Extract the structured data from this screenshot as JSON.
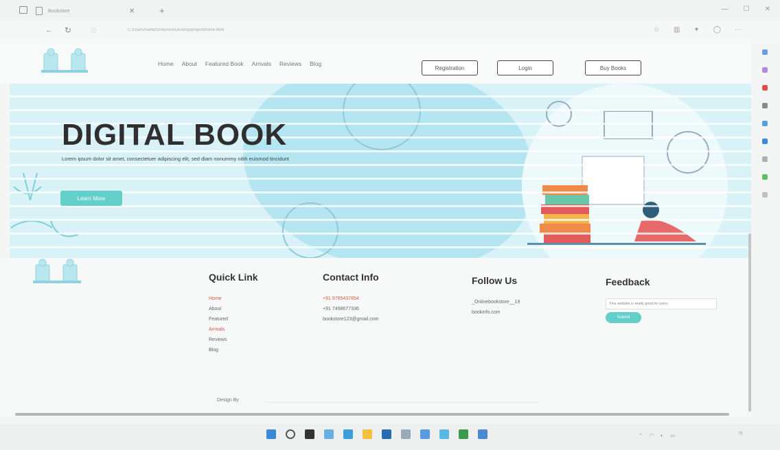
{
  "browser": {
    "tab_title": "Bookstore",
    "url": "C:/Users/name/OneDrive/Desktop/project/home.html"
  },
  "nav": {
    "links": [
      "Home",
      "About",
      "Featured Book",
      "Arrivals",
      "Reviews",
      "Blog"
    ],
    "register_label": "Registration",
    "login_label": "Login",
    "buy_label": "Buy Books"
  },
  "hero": {
    "title": "DIGITAL BOOK",
    "description": "Lorem ipsum dolor sit amet, consectetuer adipiscing elit, sed diam nonummy nibh euismod tincidunt",
    "button_label": "Learn More"
  },
  "footer": {
    "quick_link": {
      "title": "Quick Link",
      "items": [
        "Home",
        "About",
        "Featured",
        "Arrivals",
        "Reviews",
        "Blog"
      ]
    },
    "contact": {
      "title": "Contact Info",
      "phones": [
        "+91 9765437854",
        "+91 7498677336"
      ],
      "email": "bookstore123@gmail.com"
    },
    "follow": {
      "title": "Follow Us",
      "handle": "_Onlinebookstore__19",
      "site": "bookinfo.com"
    },
    "feedback": {
      "title": "Feedback",
      "input_value": "This website is really good to users",
      "button_label": "Submit"
    },
    "design_by": "Design By"
  },
  "colors": {
    "accent": "#62cfc9",
    "link_red": "#d15b4a",
    "hero_bg": "#d8f2f7"
  }
}
